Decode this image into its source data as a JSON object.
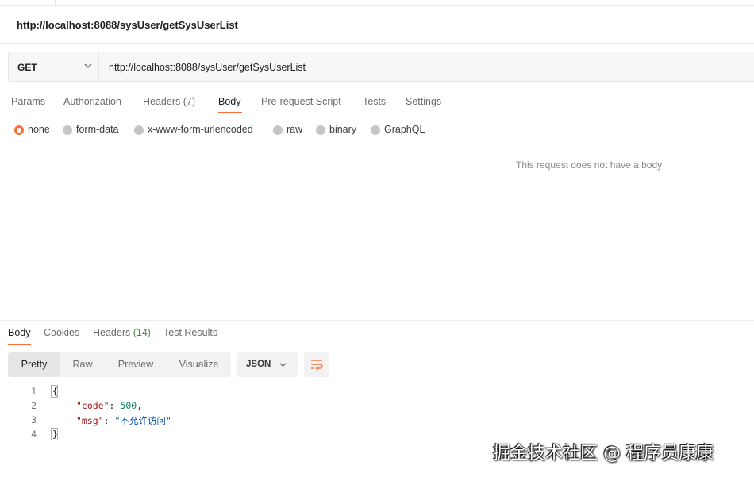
{
  "request": {
    "title": "http://localhost:8088/sysUser/getSysUserList",
    "method": "GET",
    "url": "http://localhost:8088/sysUser/getSysUserList"
  },
  "request_tabs": [
    {
      "label": "Params",
      "count": ""
    },
    {
      "label": "Authorization",
      "count": ""
    },
    {
      "label": "Headers",
      "count": "(7)"
    },
    {
      "label": "Body",
      "count": ""
    },
    {
      "label": "Pre-request Script",
      "count": ""
    },
    {
      "label": "Tests",
      "count": ""
    },
    {
      "label": "Settings",
      "count": ""
    }
  ],
  "active_request_tab": "Body",
  "body_options": [
    "none",
    "form-data",
    "x-www-form-urlencoded",
    "raw",
    "binary",
    "GraphQL"
  ],
  "selected_body_option": "none",
  "body_empty_message": "This request does not have a body",
  "response_tabs": [
    {
      "label": "Body",
      "count": ""
    },
    {
      "label": "Cookies",
      "count": ""
    },
    {
      "label": "Headers",
      "count": "(14)"
    },
    {
      "label": "Test Results",
      "count": ""
    }
  ],
  "active_response_tab": "Body",
  "view_modes": [
    "Pretty",
    "Raw",
    "Preview",
    "Visualize"
  ],
  "active_view_mode": "Pretty",
  "format": "JSON",
  "code_lines": {
    "line_numbers": [
      "1",
      "2",
      "3",
      "4"
    ],
    "open_brace": "{",
    "close_brace": "}",
    "code_key": "\"code\"",
    "code_value": "500",
    "msg_key": "\"msg\"",
    "msg_value": "\"不允许访问\""
  },
  "watermark": "掘金技术社区 @ 程序员康康",
  "colors": {
    "accent": "#ff6c37",
    "key": "#a31515",
    "number": "#098658",
    "string": "#0451a5",
    "headers_count": "#3f8f3f"
  },
  "icons": [
    "chevron-down-icon",
    "wrap-lines-icon"
  ]
}
